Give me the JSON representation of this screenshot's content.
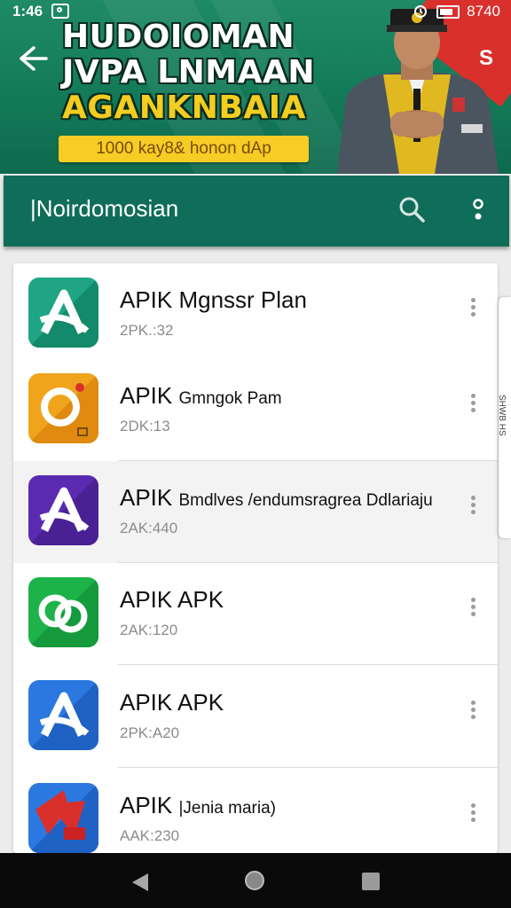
{
  "status_bar": {
    "time": "1:46",
    "right_text": "8740"
  },
  "banner": {
    "title_lines": [
      "HUDOIOMAN",
      "JVPA LNMAAN",
      "AGANKNBAIA"
    ],
    "promo": "1000 kay8& honon dAp",
    "badge": "S"
  },
  "appbar": {
    "title": "|Noirdomosian"
  },
  "apps": [
    {
      "name": "APIK Mgnssr Plan",
      "sub": "",
      "meta": "2PK.:32",
      "icon": "teal-a-icon",
      "color": "#1fa584"
    },
    {
      "name": "APIK ",
      "sub": "Gmngok Pam",
      "meta": "2DK:13",
      "icon": "orange-camera-icon",
      "color": "#f0a41c"
    },
    {
      "name": "APIK ",
      "sub": "Bmdlves /endumsragrea Ddlariaju",
      "meta": "2AK:440",
      "icon": "purple-a-icon",
      "color": "#5a2bb0",
      "selected": true
    },
    {
      "name": "APIK APK",
      "sub": "",
      "meta": "2AK:120",
      "icon": "green-rings-icon",
      "color": "#1db34a"
    },
    {
      "name": "APIK APK",
      "sub": "",
      "meta": "2PK:A20",
      "icon": "blue-a-icon",
      "color": "#2b78e0"
    },
    {
      "name": "APIK ",
      "sub": "|Jenia  maria)",
      "meta": "AAK:230",
      "icon": "red-arrow-icon",
      "color": "#2b78e0"
    }
  ],
  "side_tab": {
    "label": "SHWB HS"
  }
}
